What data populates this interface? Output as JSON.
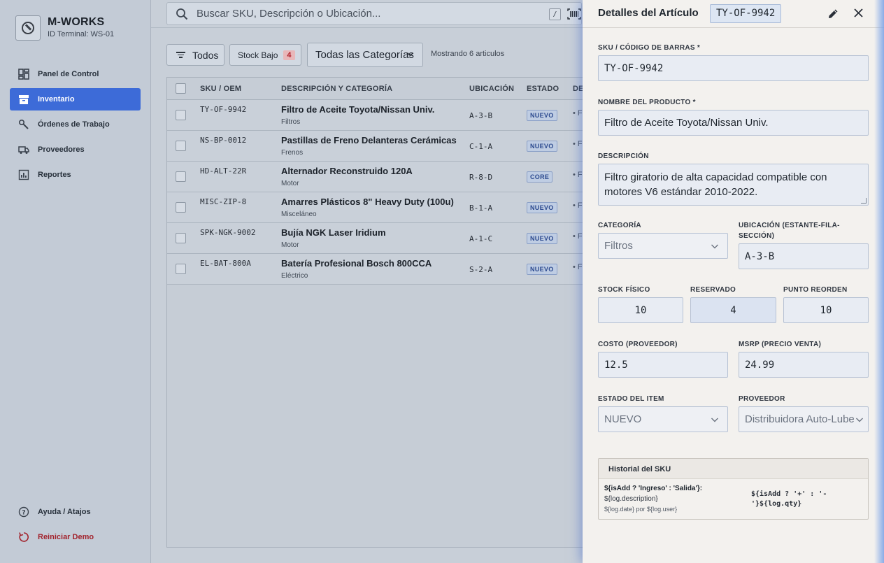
{
  "brand": {
    "title": "M-WORKS",
    "terminal": "ID Terminal: WS-01"
  },
  "sidebar": {
    "items": [
      {
        "label": "Panel de Control",
        "icon": "dashboard-icon"
      },
      {
        "label": "Inventario",
        "icon": "inventory-icon",
        "active": true
      },
      {
        "label": "Órdenes de Trabajo",
        "icon": "wrench-icon"
      },
      {
        "label": "Proveedores",
        "icon": "truck-icon"
      },
      {
        "label": "Reportes",
        "icon": "report-icon"
      }
    ],
    "help": "Ayuda / Atajos",
    "reset": "Reiniciar Demo"
  },
  "search": {
    "placeholder": "Buscar SKU, Descripción o Ubicación...",
    "shortcut": "/"
  },
  "filters": {
    "all": "Todos",
    "low_stock": "Stock Bajo",
    "low_stock_count": "4",
    "category": "Todas las Categorías",
    "showing": "Mostrando 6 articulos"
  },
  "table": {
    "headers": {
      "sku": "SKU / OEM",
      "desc": "DESCRIPCIÓN Y CATEGORÍA",
      "loc": "UBICACIÓN",
      "status": "ESTADO",
      "extra": "DE"
    },
    "rows": [
      {
        "sku": "TY-OF-9942",
        "desc": "Filtro de Aceite Toyota/Nissan Univ.",
        "cat": "Filtros",
        "loc": "A-3-B",
        "status": "NUEVO",
        "extra": "• F"
      },
      {
        "sku": "NS-BP-0012",
        "desc": "Pastillas de Freno Delanteras Cerámicas",
        "cat": "Frenos",
        "loc": "C-1-A",
        "status": "NUEVO",
        "extra": "• F"
      },
      {
        "sku": "HD-ALT-22R",
        "desc": "Alternador Reconstruido 120A",
        "cat": "Motor",
        "loc": "R-8-D",
        "status": "CORE",
        "extra": "• F"
      },
      {
        "sku": "MISC-ZIP-8",
        "desc": "Amarres Plásticos 8\" Heavy Duty (100u)",
        "cat": "Misceláneo",
        "loc": "B-1-A",
        "status": "NUEVO",
        "extra": "• F"
      },
      {
        "sku": "SPK-NGK-9002",
        "desc": "Bujía NGK Laser Iridium",
        "cat": "Motor",
        "loc": "A-1-C",
        "status": "NUEVO",
        "extra": "• F"
      },
      {
        "sku": "EL-BAT-800A",
        "desc": "Batería Profesional Bosch 800CCA",
        "cat": "Eléctrico",
        "loc": "S-2-A",
        "status": "NUEVO",
        "extra": "• F"
      }
    ]
  },
  "detail": {
    "title": "Detalles del Artículo",
    "sku_badge": "TY-OF-9942",
    "labels": {
      "sku": "SKU / CÓDIGO DE BARRAS *",
      "name": "NOMBRE DEL PRODUCTO *",
      "desc": "DESCRIPCIÓN",
      "category": "CATEGORÍA",
      "location": "UBICACIÓN (ESTANTE-FILA-SECCIÓN)",
      "stock": "STOCK FÍSICO",
      "reserved": "RESERVADO",
      "reorder": "PUNTO REORDEN",
      "cost": "COSTO (PROVEEDOR)",
      "msrp": "MSRP (PRECIO VENTA)",
      "status": "ESTADO DEL ITEM",
      "supplier": "PROVEEDOR"
    },
    "values": {
      "sku": "TY-OF-9942",
      "name": "Filtro de Aceite Toyota/Nissan Univ.",
      "desc": "Filtro giratorio de alta capacidad compatible con motores V6 estándar 2010-2022.",
      "category": "Filtros",
      "location": "A-3-B",
      "stock": "10",
      "reserved": "4",
      "reorder": "10",
      "cost": "12.5",
      "msrp": "24.99",
      "status": "NUEVO",
      "supplier": "Distribuidora Auto-Lube"
    },
    "history": {
      "title": "Historial del SKU",
      "type": "${isAdd ? 'Ingreso' : 'Salida'}:",
      "desc": "${log.description}",
      "meta": "${log.date} por ${log.user}",
      "qty": "${isAdd ? '+' : '-'}${log.qty}"
    }
  },
  "colors": {
    "accent": "#3d6bd8",
    "danger": "#a2232d",
    "panel_bg": "#f3f1ee"
  }
}
